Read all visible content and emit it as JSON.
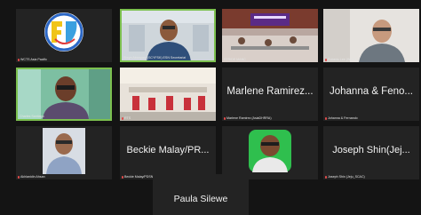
{
  "participants": [
    {
      "display_name": "",
      "tag": "WCTS Asia Pacific"
    },
    {
      "display_name": "",
      "tag": "Elwyn Abarquez (SCYFSK) ESN Secretariat"
    },
    {
      "display_name": "",
      "tag": "STRIDE MANC"
    },
    {
      "display_name": "",
      "tag": "Roberto Lee (WCC)"
    },
    {
      "display_name": "",
      "tag": "Charles Santiago"
    },
    {
      "display_name": "",
      "tag": "RTS"
    },
    {
      "display_name": "Marlene Ramirez...",
      "tag": "Marlene Ramirez (AsiaDHRRA)"
    },
    {
      "display_name": "Johanna & Feno...",
      "tag": "Johanna & Fernando"
    },
    {
      "display_name": "",
      "tag": "Akhlanidin Ahsan"
    },
    {
      "display_name": "Beckie Malay/PR...",
      "tag": "Beckie Malay/PDSN"
    },
    {
      "display_name": "",
      "tag": "TheKinsher"
    },
    {
      "display_name": "Joseph Shin(Jej...",
      "tag": "Joseph Shin (Jeju_SCAC)"
    },
    {
      "display_name": "Paula Silewe",
      "tag": ""
    }
  ],
  "colors": {
    "background": "#141414",
    "tile": "#232323",
    "active_speaker_border": "#7cc04f",
    "muted_mic": "#e24b4b"
  },
  "icons": {
    "muted": "mic-off-icon",
    "logo": "wcts-logo-icon"
  }
}
